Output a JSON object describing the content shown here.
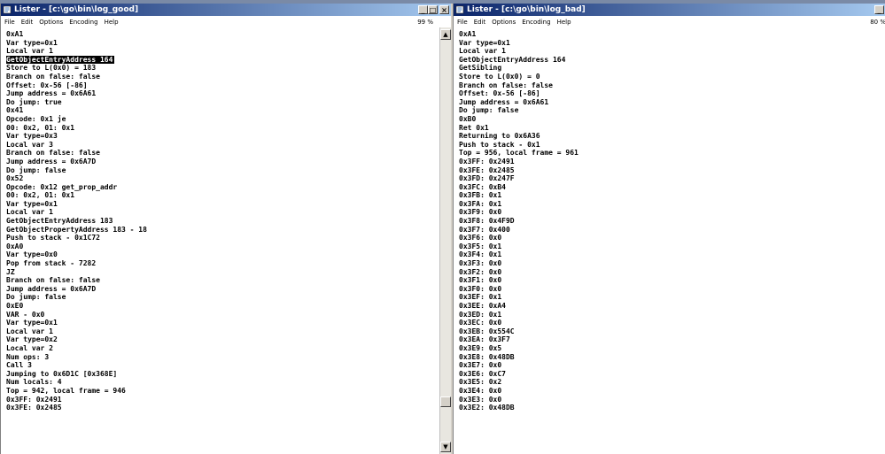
{
  "windows": [
    {
      "title": "Lister - [c:\\go\\bin\\log_good]",
      "menu": [
        "File",
        "Edit",
        "Options",
        "Encoding",
        "Help"
      ],
      "percent": "99 %",
      "lines": [
        "0xA1",
        "Var type=0x1",
        "Local var 1",
        "GetObjectEntryAddress 164",
        "Store to L(0x0) = 183",
        "Branch on false: false",
        "Offset: 0x-56 [-86]",
        "Jump address = 0x6A61",
        "Do jump: true",
        "0x41",
        "Opcode: 0x1 je",
        "00: 0x2, 01: 0x1",
        "Var type=0x3",
        "Local var 3",
        "Branch on false: false",
        "Jump address = 0x6A7D",
        "Do jump: false",
        "0x52",
        "Opcode: 0x12 get_prop_addr",
        "00: 0x2, 01: 0x1",
        "Var type=0x1",
        "Local var 1",
        "GetObjectEntryAddress 183",
        "GetObjectPropertyAddress 183 - 18",
        "Push to stack - 0x1C72",
        "0xA0",
        "Var type=0x0",
        "Pop from stack - 7282",
        "JZ",
        "Branch on false: false",
        "Jump address = 0x6A7D",
        "Do jump: false",
        "0xE0",
        "VAR - 0x0",
        "Var type=0x1",
        "Local var 1",
        "Var type=0x2",
        "Local var 2",
        "Num ops: 3",
        "Call 3",
        "Jumping to 0x6D1C [0x368E]",
        "Num locals: 4",
        "Top = 942, local frame = 946",
        "0x3FF: 0x2491",
        "0x3FE: 0x2485"
      ],
      "selected_line": "GetObjectEntryAddress 164"
    },
    {
      "title": "Lister - [c:\\go\\bin\\log_bad]",
      "menu": [
        "File",
        "Edit",
        "Options",
        "Encoding",
        "Help"
      ],
      "percent": "80 %",
      "lines": [
        "0xA1",
        "Var type=0x1",
        "Local var 1",
        "GetObjectEntryAddress 164",
        "GetSibling",
        "Store to L(0x0) = 0",
        "Branch on false: false",
        "Offset: 0x-56 [-86]",
        "Jump address = 0x6A61",
        "Do jump: false",
        "0xB0",
        "Ret 0x1",
        "Returning to 0x6A36",
        "Push to stack - 0x1",
        "Top = 956, local frame = 961",
        "0x3FF: 0x2491",
        "0x3FE: 0x2485",
        "0x3FD: 0x247F",
        "0x3FC: 0xB4",
        "0x3FB: 0x1",
        "0x3FA: 0x1",
        "0x3F9: 0x0",
        "0x3F8: 0x4F9D",
        "0x3F7: 0x400",
        "0x3F6: 0x0",
        "0x3F5: 0x1",
        "0x3F4: 0x1",
        "0x3F3: 0x0",
        "0x3F2: 0x0",
        "0x3F1: 0x0",
        "0x3F0: 0x0",
        "0x3EF: 0x1",
        "0x3EE: 0xA4",
        "0x3ED: 0x1",
        "0x3EC: 0x0",
        "0x3EB: 0x554C",
        "0x3EA: 0x3F7",
        "0x3E9: 0x5",
        "0x3E8: 0x48DB",
        "0x3E7: 0x0",
        "0x3E6: 0xC7",
        "0x3E5: 0x2",
        "0x3E4: 0x0",
        "0x3E3: 0x0",
        "0x3E2: 0x48DB"
      ]
    }
  ],
  "icons": {
    "app": "lister-app-icon",
    "minimize": "minimize-icon",
    "maximize": "maximize-icon",
    "close": "close-icon"
  },
  "colors": {
    "titlebar": "#0a246a",
    "selection": "#000000"
  }
}
